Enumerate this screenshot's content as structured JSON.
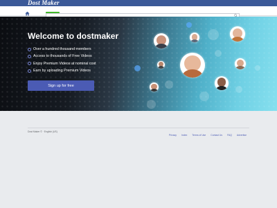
{
  "app": {
    "logo_text": "Dost Maker"
  },
  "search": {
    "placeholder": ""
  },
  "hero": {
    "title": "Welcome to dostmaker",
    "features": [
      "Over a hundred thousand members",
      "Access to thousands of Free Videos",
      "Enjoy Premium Videos at nominal cost",
      "Earn by uploading Premium Videos"
    ],
    "signup_label": "Sign up for free"
  },
  "footer": {
    "locale": "Dost Maker ©  ·  English (US)",
    "links": [
      "Privacy",
      "Index",
      "Terms of Use",
      "Contact Us",
      "FAQ",
      "Advertise"
    ]
  },
  "colors": {
    "brand": "#3b5998",
    "accent": "#4b5bb4",
    "badge": "#42b72a"
  },
  "icons": {
    "home": "home-icon",
    "search": "search-icon"
  }
}
